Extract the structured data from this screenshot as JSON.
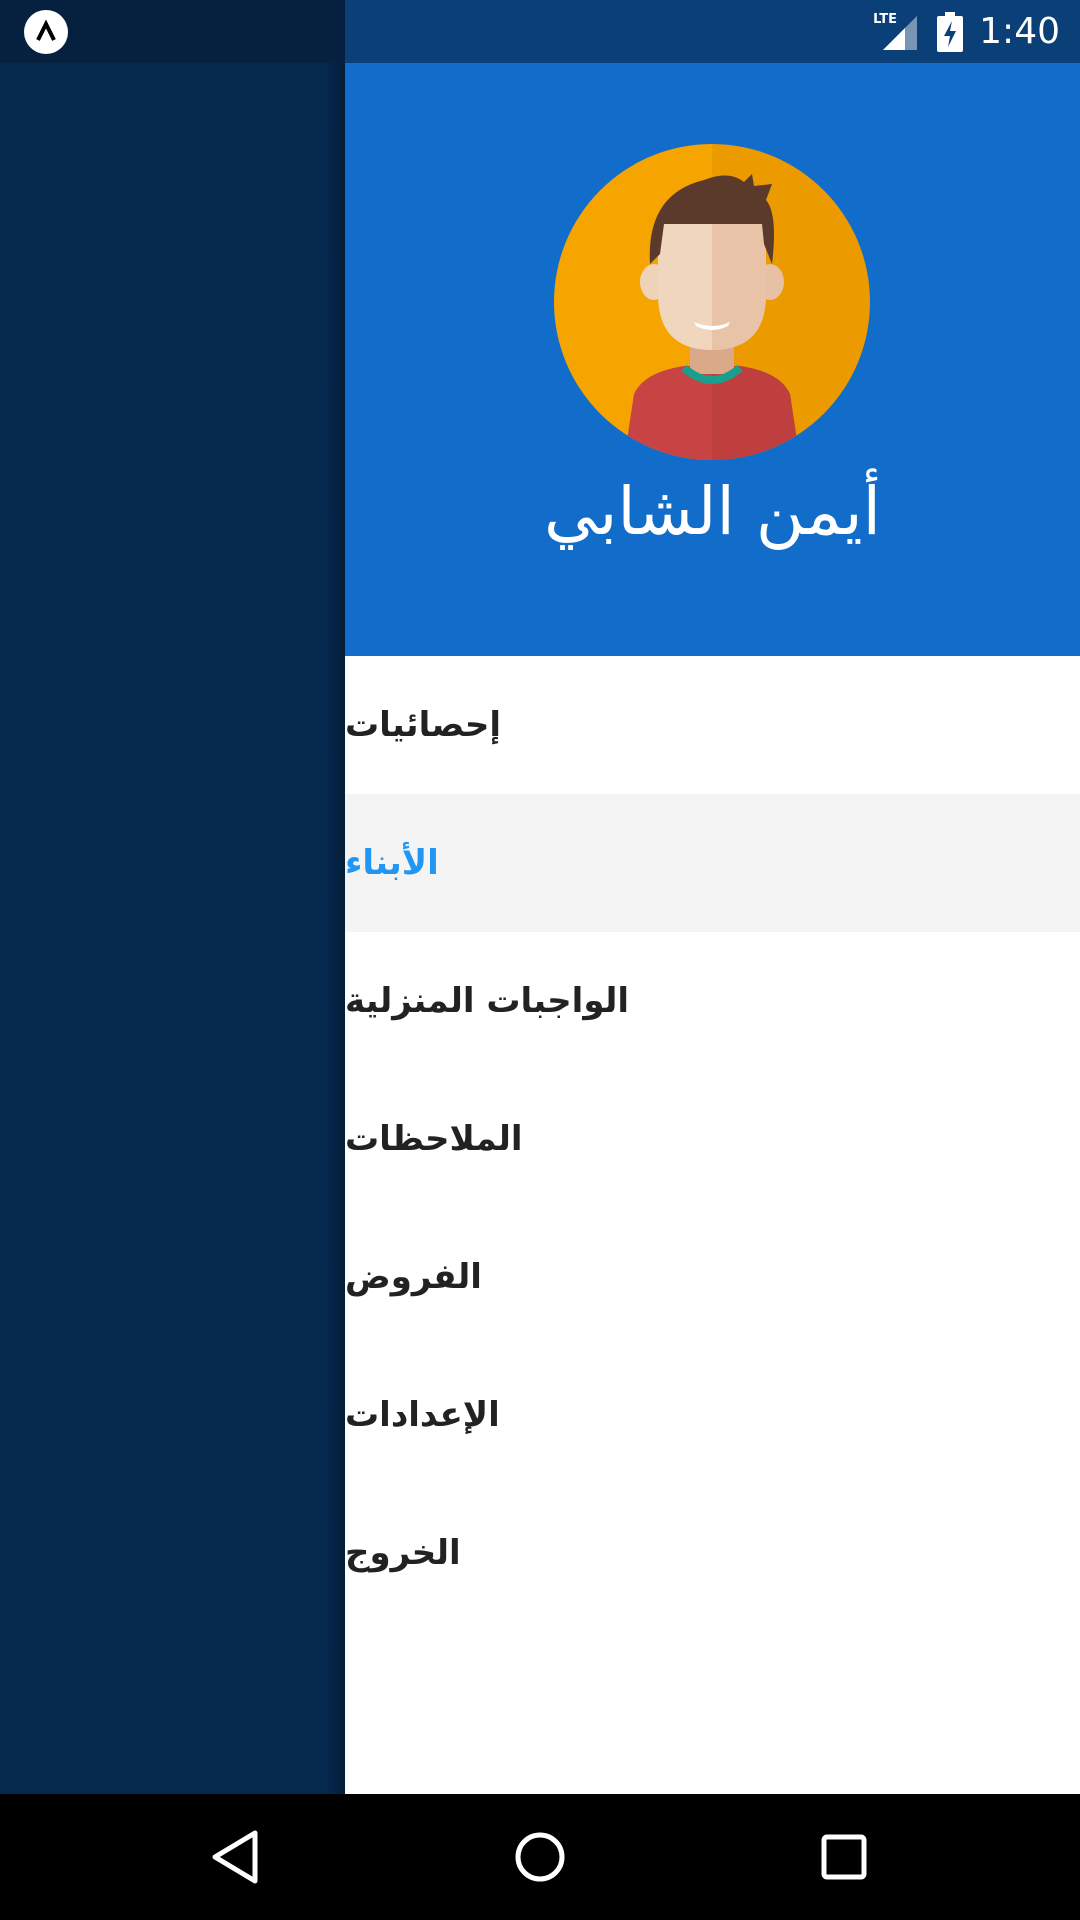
{
  "status_bar": {
    "time": "1:40",
    "network": "LTE",
    "icons": [
      "app-icon",
      "signal-icon",
      "battery-charging-icon"
    ]
  },
  "drawer": {
    "header": {
      "user_name": "أيمن الشابي",
      "avatar": "user-avatar",
      "background_color": "#116cca"
    },
    "menu": [
      {
        "label": "إحصائيات",
        "active": false
      },
      {
        "label": "الأبناء",
        "active": true
      },
      {
        "label": "الواجبات المنزلية",
        "active": false
      },
      {
        "label": "الملاحظات",
        "active": false
      },
      {
        "label": "الفروض",
        "active": false
      },
      {
        "label": "الإعدادات",
        "active": false
      },
      {
        "label": "الخروج",
        "active": false
      }
    ],
    "active_color": "#2196f3"
  },
  "nav_bar": {
    "icons": [
      "back-icon",
      "home-icon",
      "recents-icon"
    ]
  }
}
